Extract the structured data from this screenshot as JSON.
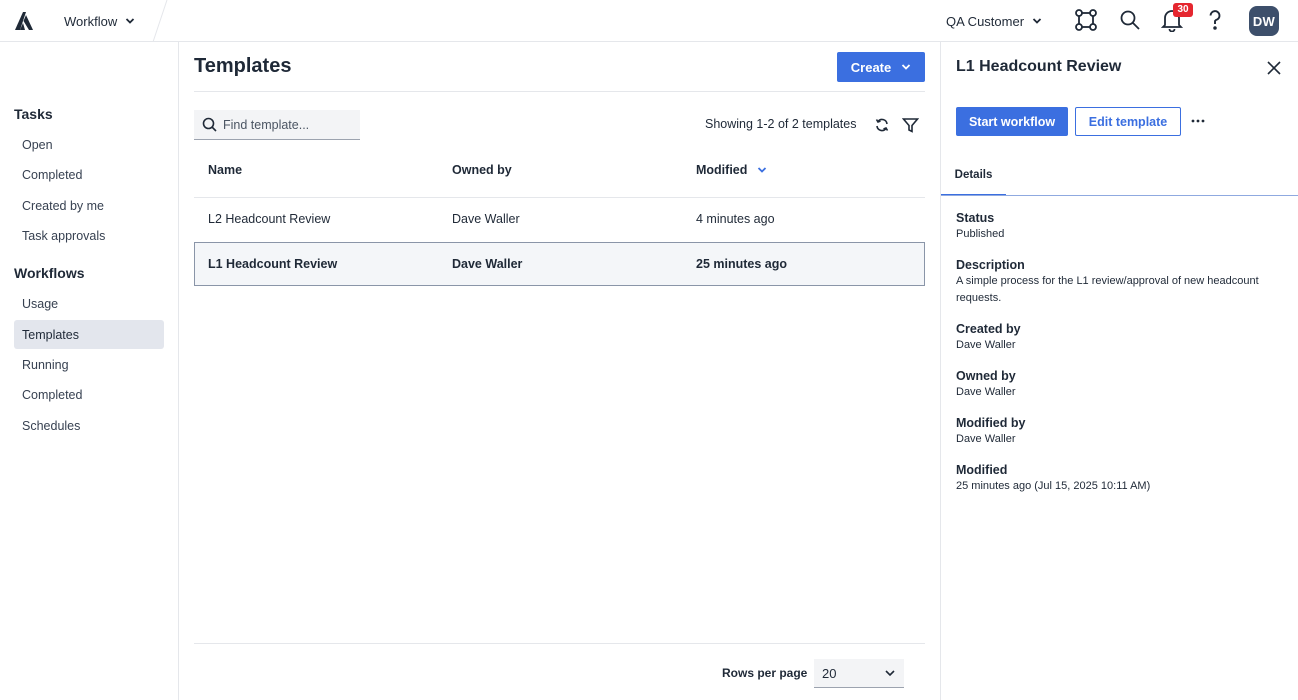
{
  "topbar": {
    "app_name": "Workflow",
    "org_name": "QA Customer",
    "notification_count": "30",
    "user_initials": "DW"
  },
  "sidebar": {
    "sections": [
      {
        "heading": "Tasks",
        "items": [
          "Open",
          "Completed",
          "Created by me",
          "Task approvals"
        ]
      },
      {
        "heading": "Workflows",
        "items": [
          "Usage",
          "Templates",
          "Running",
          "Completed",
          "Schedules"
        ]
      }
    ],
    "active_item": "Templates"
  },
  "main": {
    "title": "Templates",
    "create_label": "Create",
    "search_placeholder": "Find template...",
    "showing_text": "Showing 1-2 of 2 templates",
    "columns": {
      "name": "Name",
      "owned_by": "Owned by",
      "modified": "Modified"
    },
    "rows": [
      {
        "name": "L2 Headcount Review",
        "owned_by": "Dave Waller",
        "modified": "4 minutes ago",
        "selected": false
      },
      {
        "name": "L1 Headcount Review",
        "owned_by": "Dave Waller",
        "modified": "25 minutes ago",
        "selected": true
      }
    ],
    "rows_per_page_label": "Rows per page",
    "rows_per_page_value": "20"
  },
  "panel": {
    "title": "L1 Headcount Review",
    "start_label": "Start workflow",
    "edit_label": "Edit template",
    "more_label": "···",
    "tab_details": "Details",
    "details": [
      {
        "label": "Status",
        "value": "Published"
      },
      {
        "label": "Description",
        "value": "A simple process for the L1 review/approval of new headcount requests."
      },
      {
        "label": "Created by",
        "value": "Dave Waller"
      },
      {
        "label": "Owned by",
        "value": "Dave Waller"
      },
      {
        "label": "Modified by",
        "value": "Dave Waller"
      },
      {
        "label": "Modified",
        "value": "25 minutes ago (Jul 15, 2025 10:11 AM)"
      }
    ]
  },
  "colors": {
    "accent": "#3b6fe0",
    "badge": "#e5262f",
    "avatar": "#3d4f6b",
    "active_nav": "#e3e6ed"
  },
  "icons": [
    "app-logo-icon",
    "chevron-down-icon",
    "integrations-icon",
    "search-icon",
    "bell-icon",
    "help-icon",
    "refresh-icon",
    "filter-icon",
    "close-icon",
    "more-icon"
  ]
}
